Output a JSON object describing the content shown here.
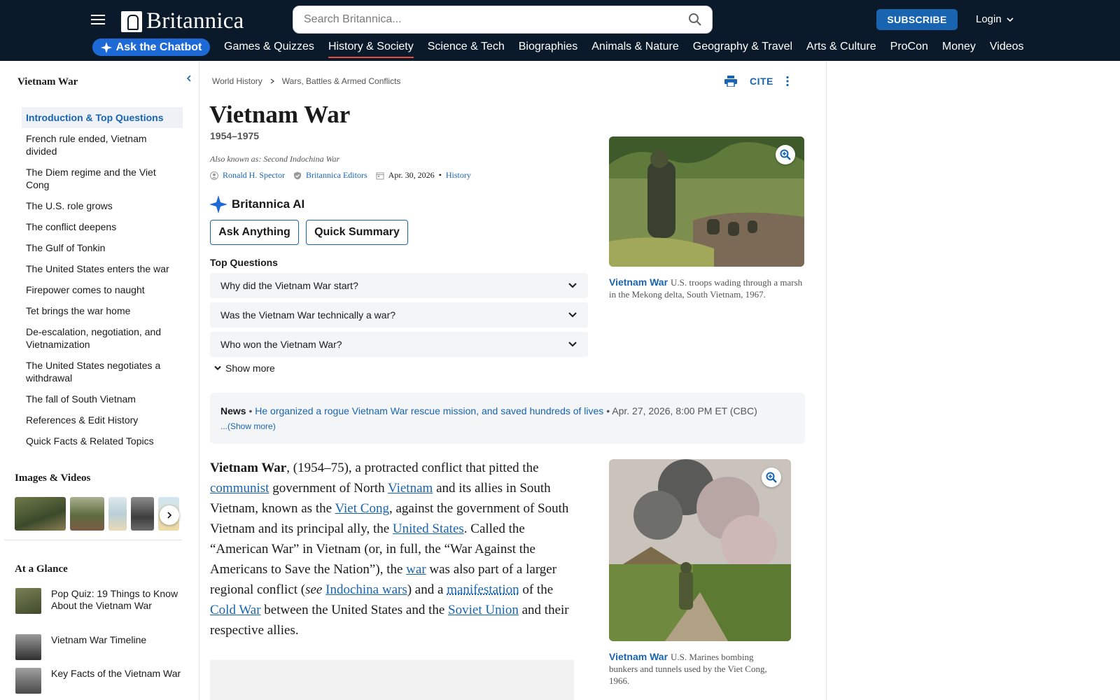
{
  "header": {
    "logo_text": "Britannica",
    "search_placeholder": "Search Britannica...",
    "subscribe_label": "SUBSCRIBE",
    "login_label": "Login",
    "chatbot_label": "Ask the Chatbot",
    "nav": [
      "Games & Quizzes",
      "History & Society",
      "Science & Tech",
      "Biographies",
      "Animals & Nature",
      "Geography & Travel",
      "Arts & Culture",
      "ProCon",
      "Money",
      "Videos"
    ],
    "active_nav": "History & Society",
    "colors": {
      "bar": "#0b1a2b",
      "accent": "#1864b0",
      "chatbot": "#1d6ad6",
      "active_underline": "#e74c3c"
    }
  },
  "sidebar": {
    "title": "Vietnam War",
    "toc": [
      "Introduction & Top Questions",
      "French rule ended, Vietnam divided",
      "The Diem regime and the Viet Cong",
      "The U.S. role grows",
      "The conflict deepens",
      "The Gulf of Tonkin",
      "The United States enters the war",
      "Firepower comes to naught",
      "Tet brings the war home",
      "De-escalation, negotiation, and Vietnamization",
      "The United States negotiates a withdrawal",
      "The fall of South Vietnam",
      "References & Edit History",
      "Quick Facts & Related Topics"
    ],
    "images_title": "Images & Videos",
    "glance_title": "At a Glance",
    "glance": [
      "Pop Quiz: 19 Things to Know About the Vietnam War",
      "Vietnam War Timeline",
      "Key Facts of the Vietnam War"
    ]
  },
  "article": {
    "breadcrumbs": [
      "World History",
      "Wars, Battles & Armed Conflicts"
    ],
    "cite_label": "CITE",
    "title": "Vietnam War",
    "dates": "1954–1975",
    "also_known_as": "Also known as: Second Indochina War",
    "author": "Ronald H. Spector",
    "editors": "Britannica Editors",
    "date": "Apr. 30, 2026",
    "bullet": "•",
    "date_link": "History",
    "ai_label": "Britannica AI",
    "ask_anything": "Ask Anything",
    "quick_summary": "Quick Summary",
    "top_questions_title": "Top Questions",
    "questions": [
      "Why did the Vietnam War start?",
      "Was the Vietnam War technically a war?",
      "Who won the Vietnam War?"
    ],
    "show_more": "Show more",
    "news": {
      "label": "News",
      "headline": "He organized a rogue Vietnam War rescue mission, and saved hundreds of lives",
      "meta": "Apr. 27, 2026, 8:00 PM ET (CBC)",
      "more": "...(Show more)"
    },
    "fig1": {
      "title": "Vietnam War",
      "caption": "U.S. troops wading through a marsh in the Mekong delta, South Vietnam, 1967."
    },
    "fig2": {
      "title": "Vietnam War",
      "caption": "U.S. Marines bombing bunkers and tunnels used by the Viet Cong, 1966."
    },
    "body": {
      "lead": "Vietnam War",
      "t1": ", (1954–75), a protracted conflict that pitted the ",
      "l1": "communist",
      "t2": " government of North ",
      "l2": "Vietnam",
      "t3": " and its allies in South Vietnam, known as the ",
      "l3": "Viet Cong",
      "t4": ", against the government of South Vietnam and its principal ally, the ",
      "l4": "United States",
      "t5": ". Called the “American War” in Vietnam (or, in full, the “War Against the Americans to Save the Nation”), the ",
      "l5": "war",
      "t6": " was also part of a larger regional conflict (",
      "see": "see",
      "t6b": " ",
      "l6": "Indochina wars",
      "t7": ") and a ",
      "l7": "manifestation",
      "t8": " of the ",
      "l8": "Cold War",
      "t9": " between the United States and the ",
      "l9": "Soviet Union",
      "t10": " and their respective allies."
    }
  }
}
